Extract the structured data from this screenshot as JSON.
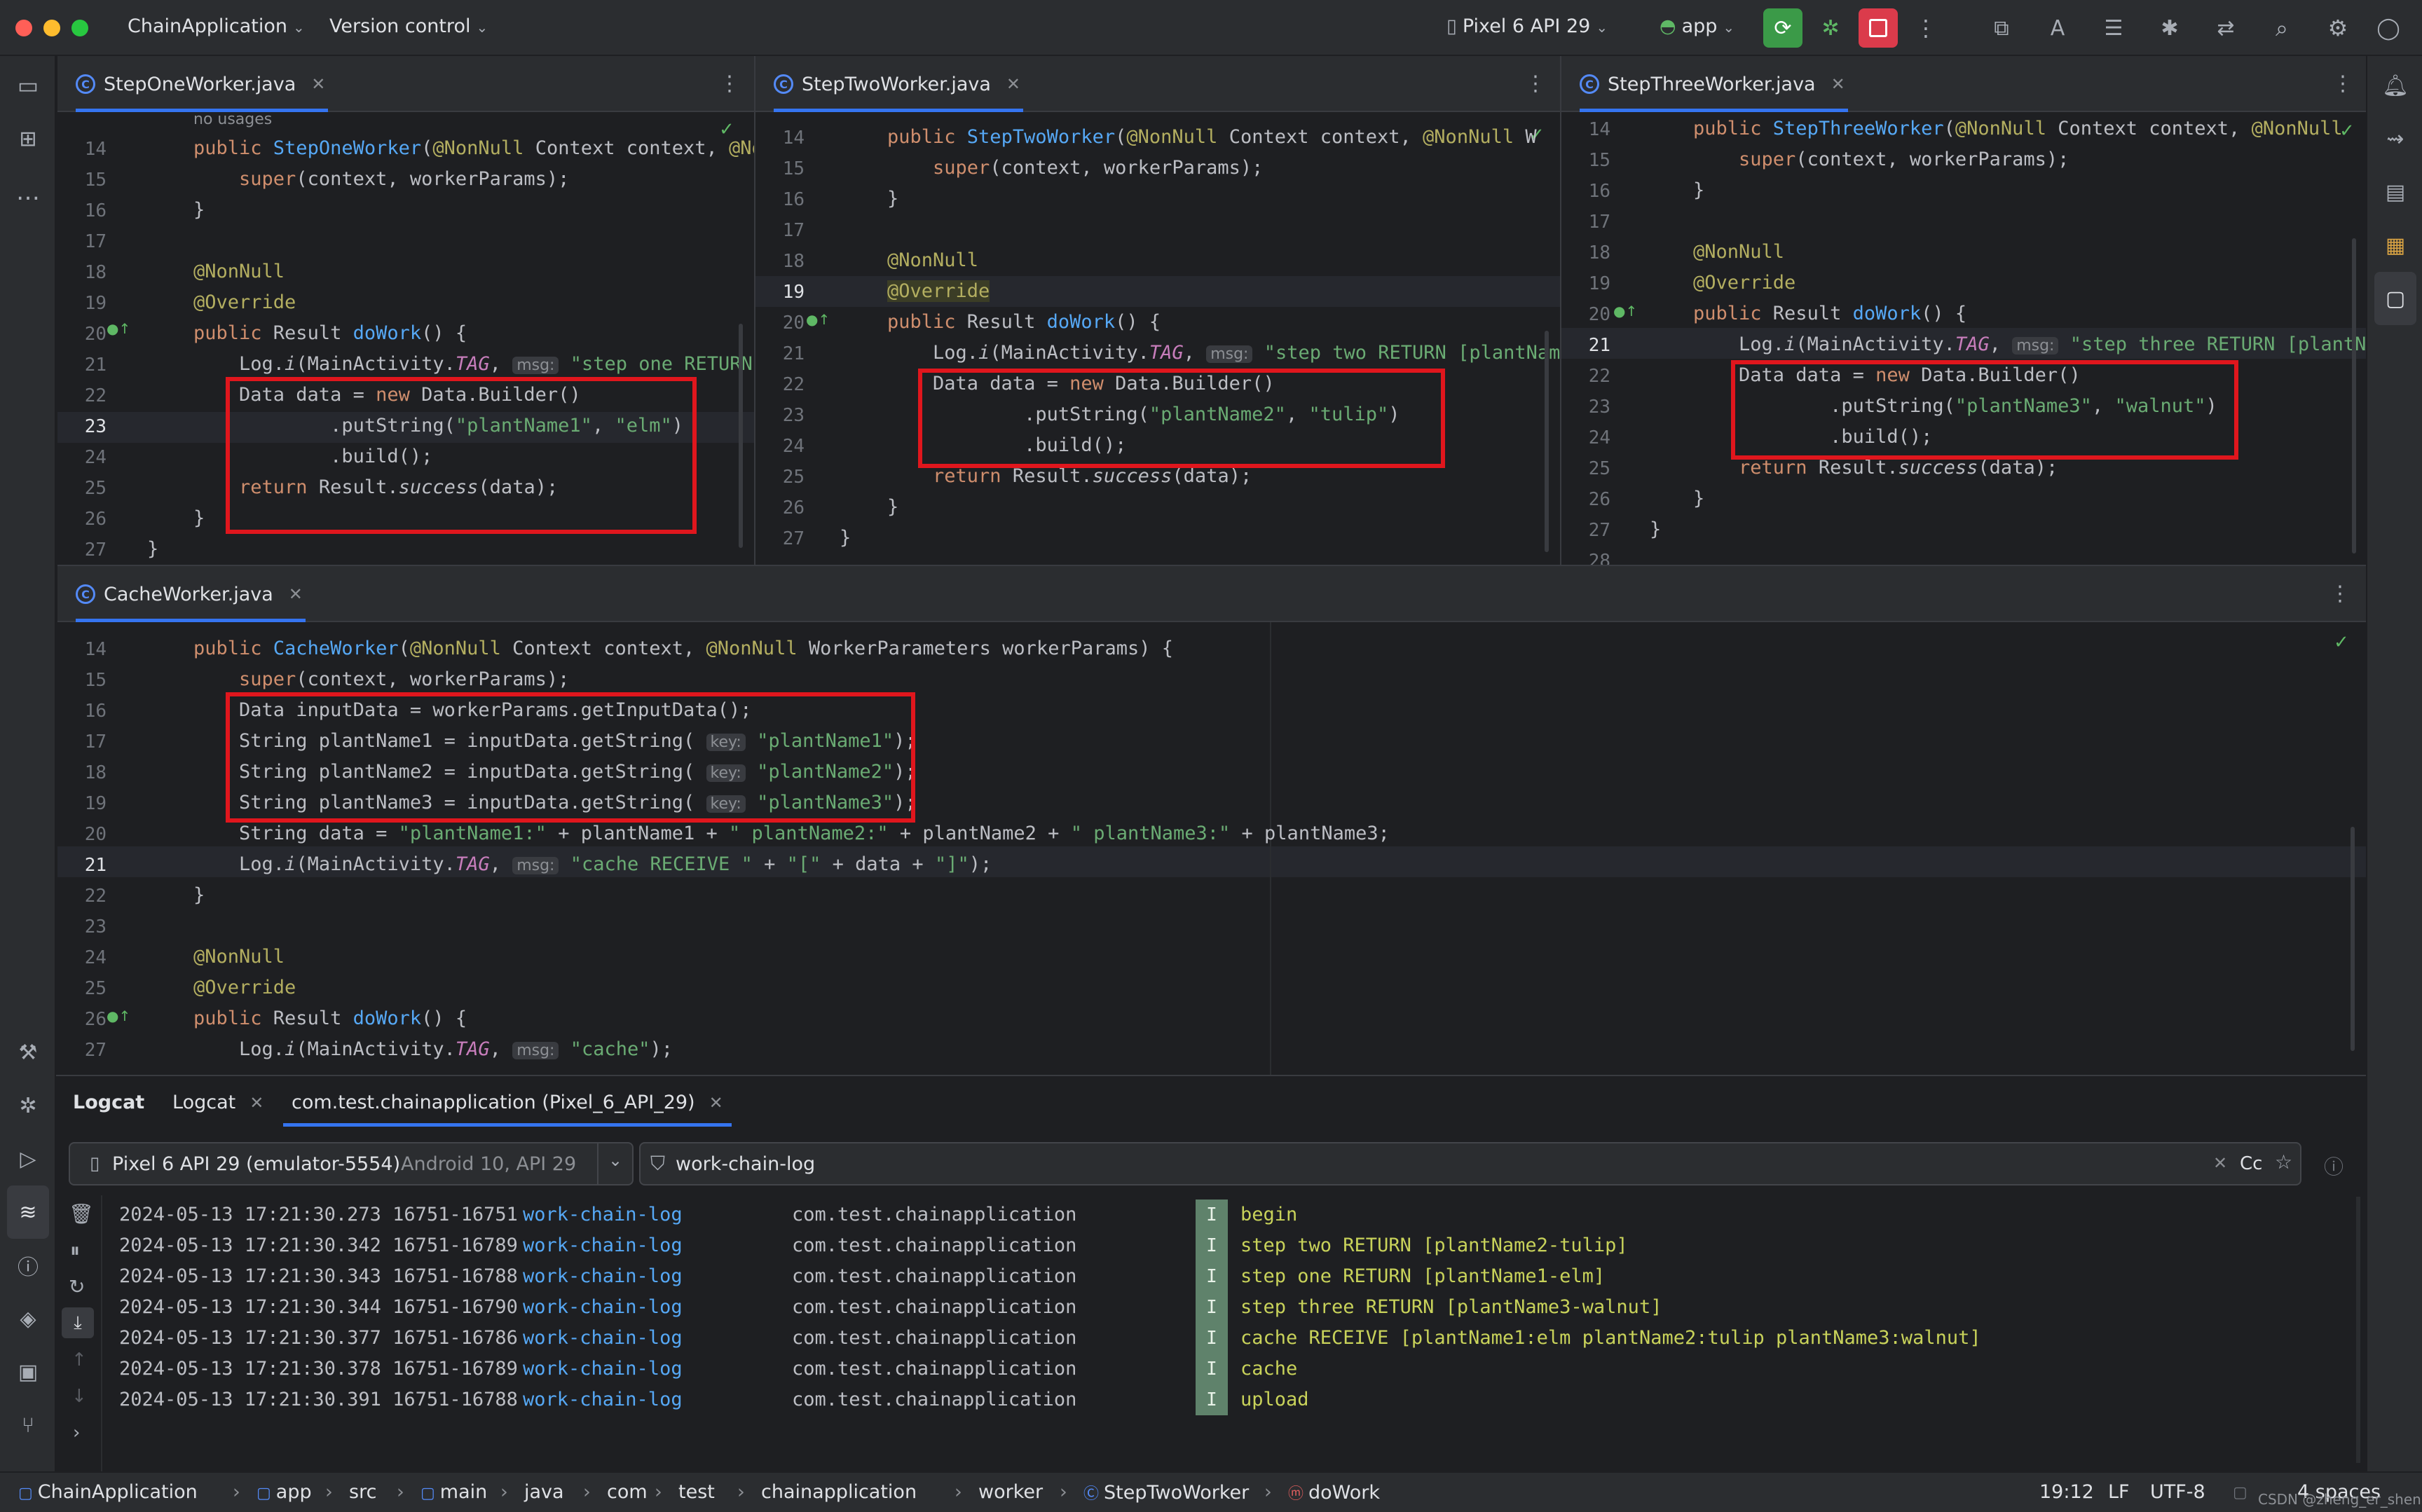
{
  "titlebar": {
    "project": "ChainApplication",
    "vcs": "Version control",
    "device": "Pixel 6 API 29",
    "run_config": "app"
  },
  "editor_top": {
    "left": {
      "tab": "StepOneWorker.java",
      "no_usages": "no usages",
      "lines": [
        "14",
        "15",
        "16",
        "17",
        "18",
        "19",
        "20",
        "21",
        "22",
        "23",
        "24",
        "25",
        "26",
        "27"
      ],
      "current_line": "23"
    },
    "middle": {
      "tab": "StepTwoWorker.java",
      "lines": [
        "14",
        "15",
        "16",
        "17",
        "18",
        "19",
        "20",
        "21",
        "22",
        "23",
        "24",
        "25",
        "26",
        "27"
      ],
      "current_line": "19"
    },
    "right": {
      "tab": "StepThreeWorker.java",
      "lines": [
        "14",
        "15",
        "16",
        "17",
        "18",
        "19",
        "20",
        "21",
        "22",
        "23",
        "24",
        "25",
        "26",
        "27",
        "28"
      ],
      "current_line": "21"
    }
  },
  "editor_bottom": {
    "tab": "CacheWorker.java",
    "lines": [
      "14",
      "15",
      "16",
      "17",
      "18",
      "19",
      "20",
      "21",
      "22",
      "23",
      "24",
      "25",
      "26",
      "27"
    ],
    "current_line": "21"
  },
  "logcat": {
    "tabs": [
      "Logcat",
      "Logcat",
      "com.test.chainapplication (Pixel_6_API_29)"
    ],
    "device_selector": "Pixel 6 API 29 (emulator-5554)",
    "device_detail": "Android 10, API 29",
    "filter": "work-chain-log",
    "case_label": "Cc",
    "rows": [
      {
        "time": "2024-05-13 17:21:30.273 16751-16751",
        "tag": "work-chain-log",
        "pkg": "com.test.chainapplication",
        "level": "I",
        "msg": "begin"
      },
      {
        "time": "2024-05-13 17:21:30.342 16751-16789",
        "tag": "work-chain-log",
        "pkg": "com.test.chainapplication",
        "level": "I",
        "msg": "step two RETURN [plantName2-tulip]"
      },
      {
        "time": "2024-05-13 17:21:30.343 16751-16788",
        "tag": "work-chain-log",
        "pkg": "com.test.chainapplication",
        "level": "I",
        "msg": "step one RETURN [plantName1-elm]"
      },
      {
        "time": "2024-05-13 17:21:30.344 16751-16790",
        "tag": "work-chain-log",
        "pkg": "com.test.chainapplication",
        "level": "I",
        "msg": "step three RETURN [plantName3-walnut]"
      },
      {
        "time": "2024-05-13 17:21:30.377 16751-16786",
        "tag": "work-chain-log",
        "pkg": "com.test.chainapplication",
        "level": "I",
        "msg": "cache RECEIVE [plantName1:elm plantName2:tulip plantName3:walnut]"
      },
      {
        "time": "2024-05-13 17:21:30.378 16751-16789",
        "tag": "work-chain-log",
        "pkg": "com.test.chainapplication",
        "level": "I",
        "msg": "cache"
      },
      {
        "time": "2024-05-13 17:21:30.391 16751-16788",
        "tag": "work-chain-log",
        "pkg": "com.test.chainapplication",
        "level": "I",
        "msg": "upload"
      }
    ]
  },
  "statusbar": {
    "crumbs": [
      "ChainApplication",
      "app",
      "src",
      "main",
      "java",
      "com",
      "test",
      "chainapplication",
      "worker",
      "StepTwoWorker",
      "doWork"
    ],
    "position": "19:12",
    "line_sep": "LF",
    "encoding": "UTF-8",
    "indent": "4 spaces",
    "watermark": "CSDN @zheng_er_sheng"
  },
  "colors": {
    "accent": "#3574f0",
    "highlight_box": "#e0161d",
    "log_info": "#5f826b",
    "log_msg": "#c8d25a",
    "tag": "#56a8f5"
  }
}
